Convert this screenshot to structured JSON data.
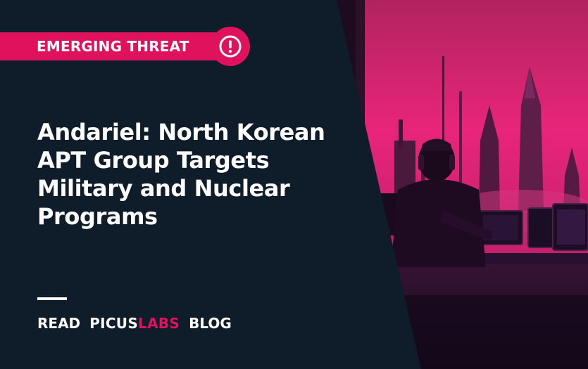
{
  "tag": {
    "label": "EMERGING THREAT",
    "icon": "exclamation-circle-icon"
  },
  "title": {
    "lines": [
      "Andariel: North Korean",
      "APT Group Targets",
      "Military and Nuclear",
      "Programs"
    ]
  },
  "cta": {
    "read": "READ",
    "brand_primary": "PICUS",
    "brand_accent": "LABS",
    "blog": "BLOG"
  },
  "colors": {
    "accent": "#e0125e",
    "background": "#0f1c29",
    "text": "#ffffff"
  },
  "illustration": {
    "subject": "hooded-hacker-with-headphones-at-monitors-watching-rocket-launch",
    "icon": "illustration-image"
  }
}
